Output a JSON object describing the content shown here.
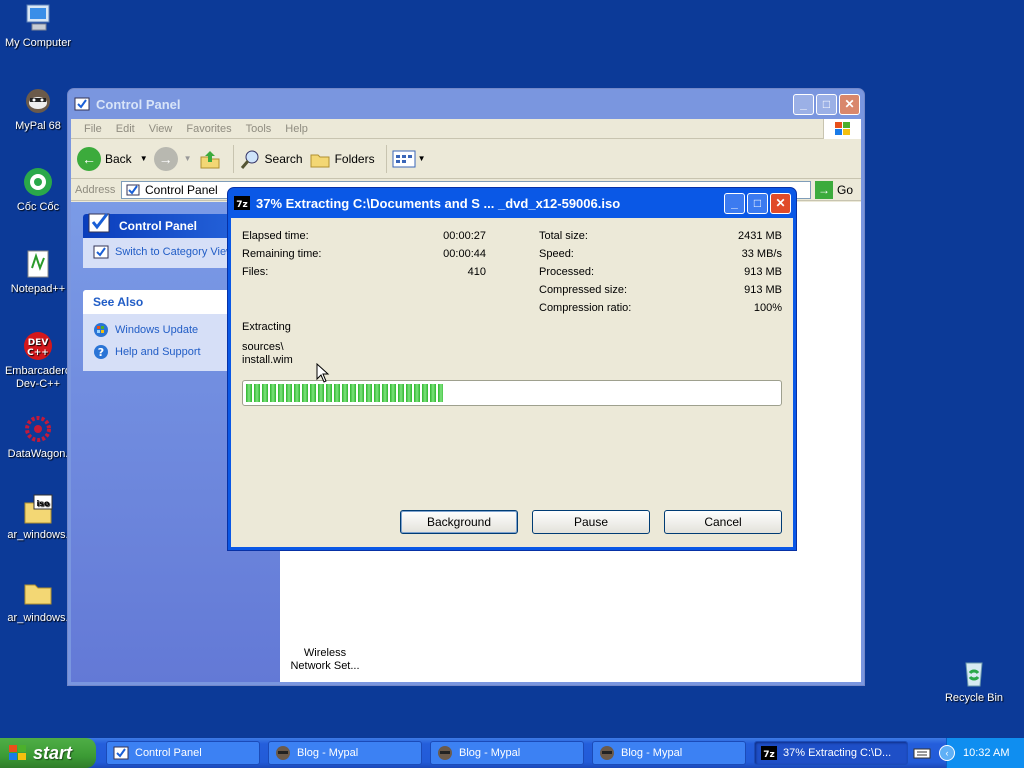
{
  "desktop": {
    "icons": [
      {
        "label": "My Computer"
      },
      {
        "label": "MyPal 68"
      },
      {
        "label": "Cốc Cốc"
      },
      {
        "label": "Notepad++"
      },
      {
        "label": "Embarcadero Dev-C++"
      },
      {
        "label": "DataWagon."
      },
      {
        "label": "ar_windows."
      },
      {
        "label": "ar_windows."
      },
      {
        "label": "Recycle Bin"
      }
    ]
  },
  "control_panel": {
    "title": "Control Panel",
    "menu": [
      "File",
      "Edit",
      "View",
      "Favorites",
      "Tools",
      "Help"
    ],
    "toolbar": {
      "back": "Back",
      "search": "Search",
      "folders": "Folders"
    },
    "address_label": "Address",
    "address_value": "Control Panel",
    "go_label": "Go",
    "task_pane": {
      "cp_header": "Control Panel",
      "switch_link": "Switch to Category View",
      "see_also_header": "See Also",
      "see_also_links": [
        "Windows Update",
        "Help and Support"
      ]
    },
    "visible_item": "Wireless Network Set..."
  },
  "zip_dialog": {
    "title": "37% Extracting C:\\Documents and S ... _dvd_x12-59006.iso",
    "left_stats": [
      {
        "label": "Elapsed time:",
        "value": "00:00:27"
      },
      {
        "label": "Remaining time:",
        "value": "00:00:44"
      },
      {
        "label": "Files:",
        "value": "410"
      }
    ],
    "right_stats": [
      {
        "label": "Total size:",
        "value": "2431 MB"
      },
      {
        "label": "Speed:",
        "value": "33 MB/s"
      },
      {
        "label": "Processed:",
        "value": "913 MB"
      },
      {
        "label": "Compressed size:",
        "value": "913 MB"
      },
      {
        "label": "Compression ratio:",
        "value": "100%"
      }
    ],
    "status": "Extracting",
    "path_line1": "sources\\",
    "path_line2": "install.wim",
    "progress_percent": 37,
    "buttons": {
      "background": "Background",
      "pause": "Pause",
      "cancel": "Cancel"
    }
  },
  "taskbar": {
    "start_label": "start",
    "tasks": [
      "Control Panel",
      "Blog - Mypal",
      "Blog - Mypal",
      "Blog - Mypal",
      "37% Extracting C:\\D..."
    ],
    "clock": "10:32 AM"
  }
}
